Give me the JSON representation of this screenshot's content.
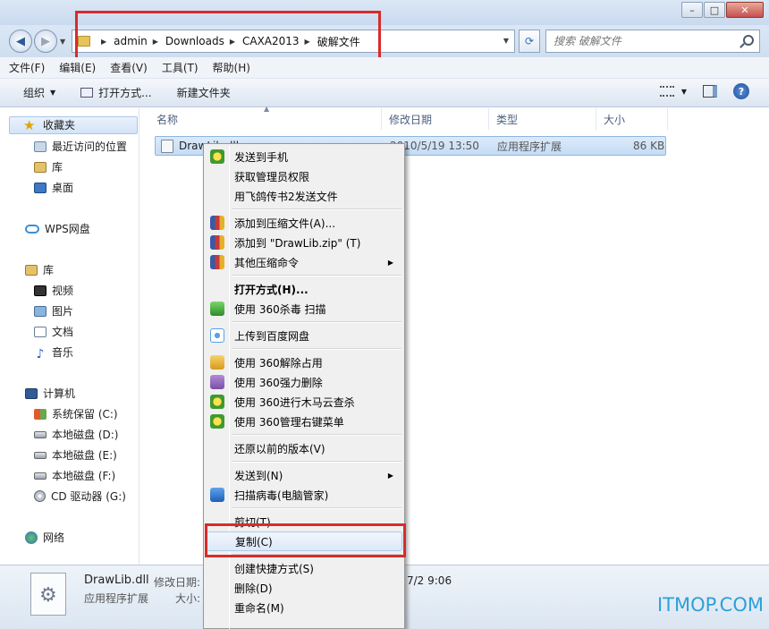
{
  "window": {
    "minimize": "–",
    "maximize": "□",
    "close": "✕"
  },
  "address": {
    "crumbs": [
      "admin",
      "Downloads",
      "CAXA2013",
      "破解文件"
    ],
    "search_placeholder": "搜索 破解文件"
  },
  "menubar": [
    "文件(F)",
    "编辑(E)",
    "查看(V)",
    "工具(T)",
    "帮助(H)"
  ],
  "toolbar": {
    "organize": "组织",
    "open_with": "打开方式...",
    "new_folder": "新建文件夹"
  },
  "navpane": {
    "favorites": "收藏夹",
    "recent": "最近访问的位置",
    "library_fav": "库",
    "desktop": "桌面",
    "wps": "WPS网盘",
    "library": "库",
    "videos": "视频",
    "pictures": "图片",
    "documents": "文档",
    "music": "音乐",
    "computer": "计算机",
    "drive_c": "系统保留 (C:)",
    "drive_d": "本地磁盘 (D:)",
    "drive_e": "本地磁盘 (E:)",
    "drive_f": "本地磁盘 (F:)",
    "drive_g": "CD 驱动器 (G:)",
    "network": "网络"
  },
  "columns": {
    "name": "名称",
    "modified": "修改日期",
    "type": "类型",
    "size": "大小"
  },
  "file": {
    "name": "DrawLib.dll",
    "modified": "2010/5/19 13:50",
    "type": "应用程序扩展",
    "size": "86 KB"
  },
  "details": {
    "name": "DrawLib.dll",
    "modified_label": "修改日期:",
    "type": "应用程序扩展",
    "size_label": "大小:",
    "date_tail": "7/2 9:06"
  },
  "context_menu": [
    "发送到手机",
    "获取管理员权限",
    "用飞鸽传书2发送文件",
    "添加到压缩文件(A)...",
    "添加到 \"DrawLib.zip\" (T)",
    "其他压缩命令",
    "打开方式(H)...",
    "使用 360杀毒 扫描",
    "上传到百度网盘",
    "使用 360解除占用",
    "使用 360强力删除",
    "使用 360进行木马云查杀",
    "使用 360管理右键菜单",
    "还原以前的版本(V)",
    "发送到(N)",
    "扫描病毒(电脑管家)",
    "剪切(T)",
    "复制(C)",
    "创建快捷方式(S)",
    "删除(D)",
    "重命名(M)"
  ],
  "watermark": "ITMOP.COM",
  "colors": {
    "highlight_red": "#d92b2b",
    "selection_blue": "#c4dcf5",
    "watermark": "#2fa0d8"
  }
}
